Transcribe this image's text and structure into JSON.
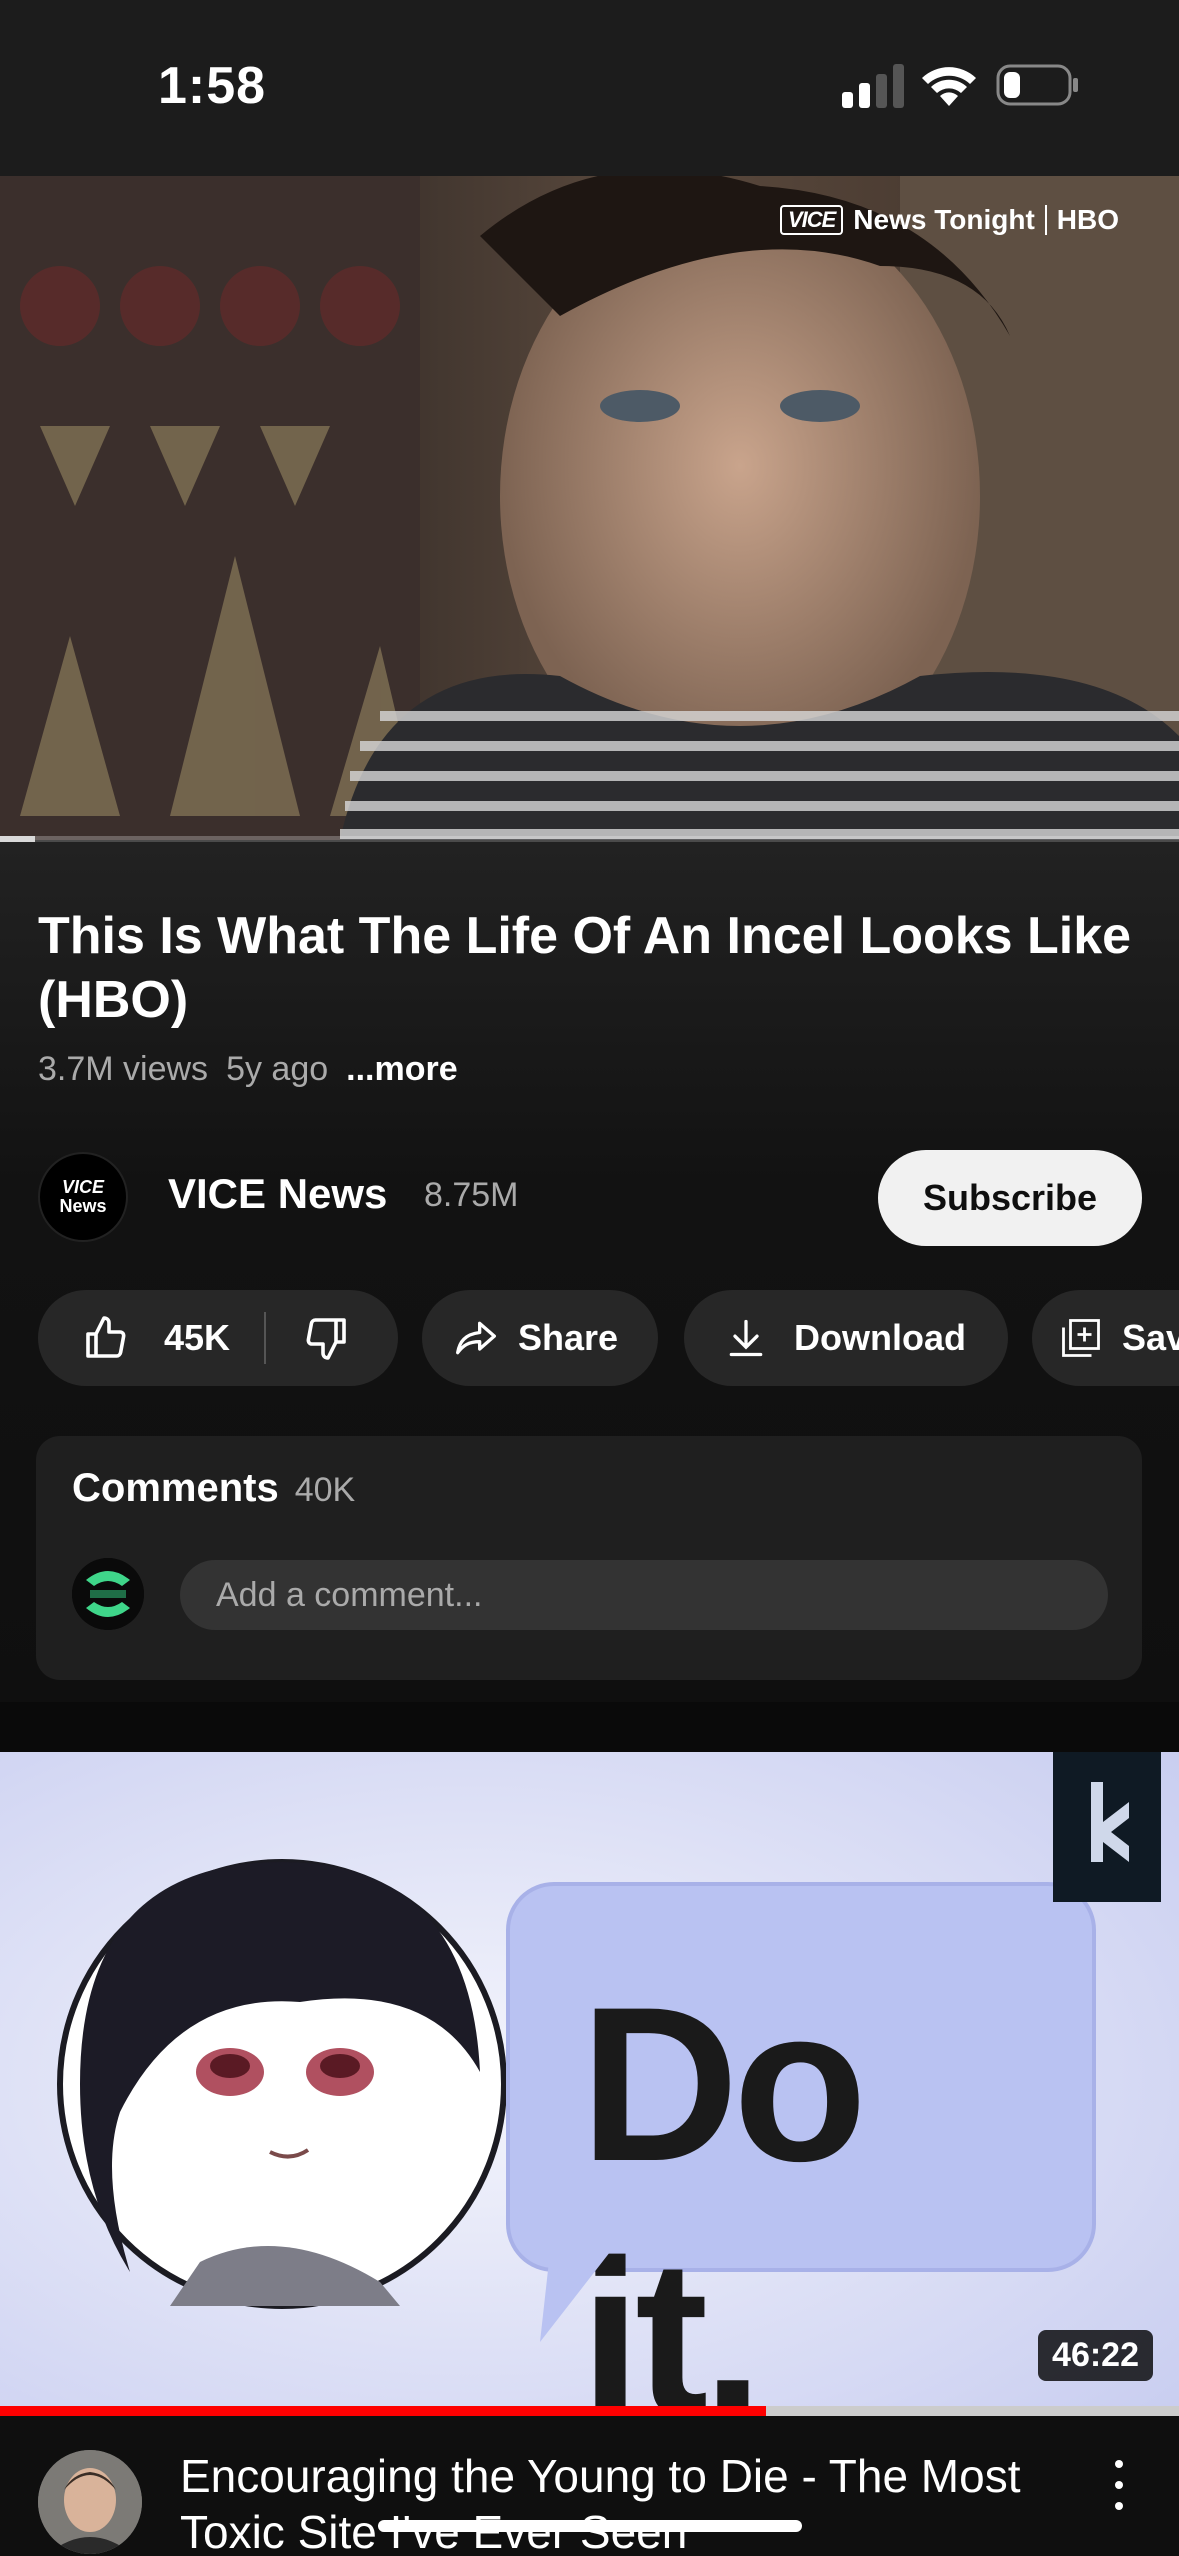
{
  "status_bar": {
    "time": "1:58"
  },
  "player": {
    "watermark_brand": "VICE",
    "watermark_show": "News Tonight",
    "watermark_network": "HBO",
    "progress": 0.03
  },
  "video": {
    "title": "This Is What The Life Of An Incel Looks Like (HBO)",
    "views": "3.7M views",
    "age": "5y ago",
    "more_label": "...more"
  },
  "channel": {
    "avatar_top": "VICE",
    "avatar_bottom": "News",
    "name": "VICE News",
    "subscribers": "8.75M",
    "subscribe_label": "Subscribe"
  },
  "actions": {
    "like_count": "45K",
    "share_label": "Share",
    "download_label": "Download",
    "save_label": "Save"
  },
  "comments": {
    "label": "Comments",
    "count": "40K",
    "placeholder": "Add a comment..."
  },
  "next_video": {
    "thumbnail_text": "Do it.",
    "duration": "46:22",
    "watched_fraction": 0.65,
    "title": "Encouraging the Young to Die - The Most Toxic Site I've Ever Seen"
  },
  "colors": {
    "background": "#0f0f0f",
    "pill": "#272727",
    "subscribe_bg": "#f1f1f1",
    "progress_red": "#ff0000",
    "bubble": "#b9c2f2"
  }
}
